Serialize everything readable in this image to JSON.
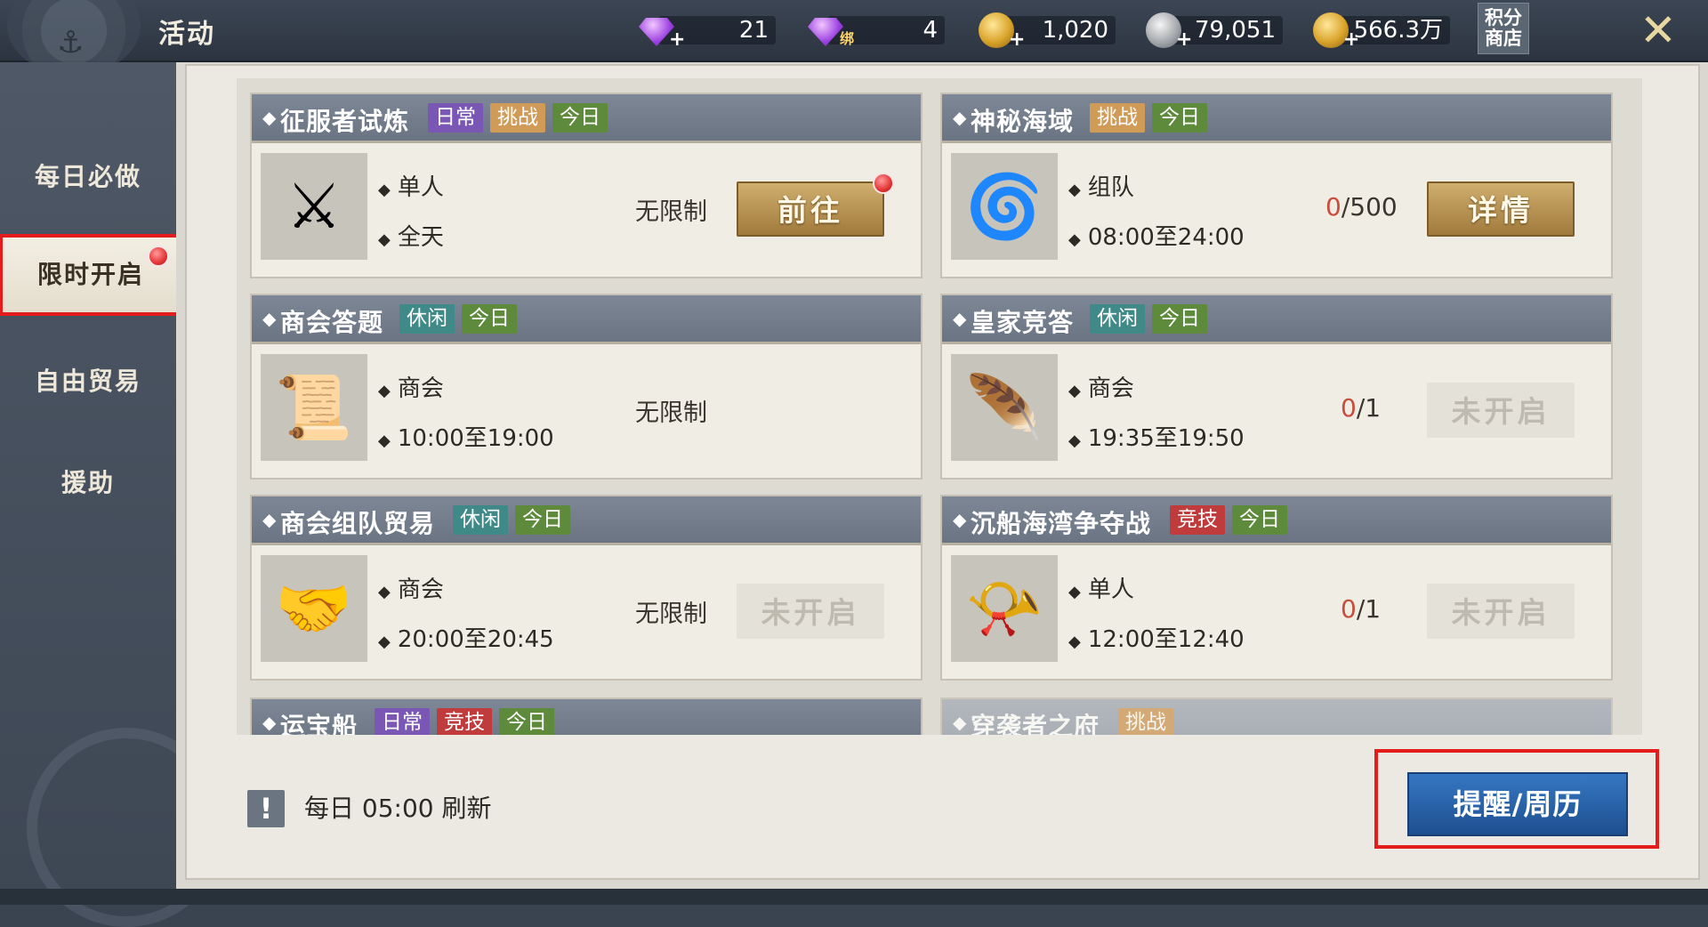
{
  "header": {
    "title": "活动",
    "currencies": [
      {
        "name": "diamond-icon",
        "value": "21"
      },
      {
        "name": "bound-diamond-icon",
        "badge": "绑",
        "value": "4"
      },
      {
        "name": "gold-coin-icon",
        "value": "1,020"
      },
      {
        "name": "silver-coin-icon",
        "value": "79,051"
      },
      {
        "name": "coin-stack-icon",
        "value": "566.3万"
      }
    ],
    "shop_label": "积分\n商店",
    "close_icon": "close-icon"
  },
  "sidebar": {
    "items": [
      {
        "label": "每日必做",
        "active": false
      },
      {
        "label": "限时开启",
        "active": true,
        "badge": "red-dot"
      },
      {
        "label": "自由贸易",
        "active": false
      },
      {
        "label": "援助",
        "active": false
      }
    ]
  },
  "activities": [
    {
      "title": "征服者试炼",
      "tags": [
        {
          "text": "日常",
          "color": "#7a57b4"
        },
        {
          "text": "挑战",
          "color": "#d09a57"
        },
        {
          "text": "今日",
          "color": "#5e8a3c"
        }
      ],
      "icon": "crossed-swords-icon",
      "mode": "单人",
      "time": "全天",
      "limit": "无限制",
      "button": "前往",
      "button_state": "active",
      "badge": "red-dot"
    },
    {
      "title": "神秘海域",
      "tags": [
        {
          "text": "挑战",
          "color": "#d09a57"
        },
        {
          "text": "今日",
          "color": "#5e8a3c"
        }
      ],
      "icon": "vortex-icon",
      "mode": "组队",
      "time": "08:00至24:00",
      "progress_current": "0",
      "progress_total": "/500",
      "button": "详情",
      "button_state": "active"
    },
    {
      "title": "商会答题",
      "tags": [
        {
          "text": "休闲",
          "color": "#3f8a88"
        },
        {
          "text": "今日",
          "color": "#5e8a3c"
        }
      ],
      "icon": "book-quill-icon",
      "mode": "商会",
      "time": "10:00至19:00",
      "limit": "无限制",
      "button": "",
      "button_state": "none"
    },
    {
      "title": "皇家竞答",
      "tags": [
        {
          "text": "休闲",
          "color": "#3f8a88"
        },
        {
          "text": "今日",
          "color": "#5e8a3c"
        }
      ],
      "icon": "scroll-quill-icon",
      "mode": "商会",
      "time": "19:35至19:50",
      "progress_current": "0",
      "progress_total": "/1",
      "button": "未开启",
      "button_state": "disabled"
    },
    {
      "title": "商会组队贸易",
      "tags": [
        {
          "text": "休闲",
          "color": "#3f8a88"
        },
        {
          "text": "今日",
          "color": "#5e8a3c"
        }
      ],
      "icon": "handshake-coin-icon",
      "mode": "商会",
      "time": "20:00至20:45",
      "limit": "无限制",
      "button": "未开启",
      "button_state": "disabled"
    },
    {
      "title": "沉船海湾争夺战",
      "tags": [
        {
          "text": "竞技",
          "color": "#c03b3b"
        },
        {
          "text": "今日",
          "color": "#5e8a3c"
        }
      ],
      "icon": "horn-icon",
      "mode": "单人",
      "time": "12:00至12:40",
      "progress_current": "0",
      "progress_total": "/1",
      "button": "未开启",
      "button_state": "disabled"
    },
    {
      "title": "运宝船",
      "tags": [
        {
          "text": "日常",
          "color": "#7a57b4"
        },
        {
          "text": "竞技",
          "color": "#c03b3b"
        },
        {
          "text": "今日",
          "color": "#5e8a3c"
        }
      ],
      "partial": true
    },
    {
      "title": "穿袭者之府",
      "tags": [
        {
          "text": "挑战",
          "color": "#d09a57"
        }
      ],
      "partial": true
    }
  ],
  "footer": {
    "refresh_icon": "exclamation-icon",
    "refresh_text": "每日 05:00 刷新",
    "calendar_button": "提醒/周历"
  }
}
